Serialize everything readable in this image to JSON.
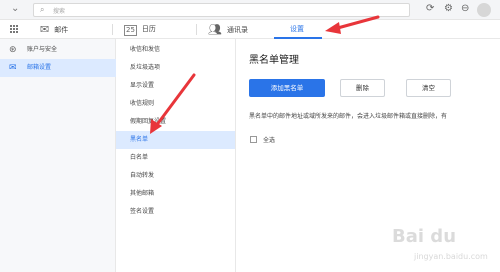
{
  "topbar": {
    "search_placeholder": "搜索",
    "icons": [
      "chevron-down-icon",
      "search-icon",
      "refresh-icon",
      "settings-icon",
      "minimize-icon",
      "avatar"
    ]
  },
  "nav": {
    "items": [
      {
        "label": "邮件",
        "icon": "mail-icon"
      },
      {
        "label": "日历",
        "icon": "calendar-icon",
        "glyph_text": "25"
      },
      {
        "label": "通讯录",
        "icon": "contacts-icon"
      },
      {
        "label": "设置",
        "active": true
      }
    ]
  },
  "sidebar": {
    "items": [
      {
        "label": "账户与安全",
        "icon": "user-icon"
      },
      {
        "label": "邮箱设置",
        "icon": "mailbox-icon",
        "selected": true
      }
    ]
  },
  "subsidebar": {
    "items": [
      {
        "label": "收信和发信"
      },
      {
        "label": "反垃圾选项"
      },
      {
        "label": "显示设置"
      },
      {
        "label": "收信规则"
      },
      {
        "label": "假期回复设置"
      },
      {
        "label": "黑名单",
        "selected": true
      },
      {
        "label": "白名单"
      },
      {
        "label": "自动转发"
      },
      {
        "label": "其他邮箱"
      },
      {
        "label": "签名设置"
      }
    ]
  },
  "main": {
    "title": "黑名单管理",
    "buttons": {
      "add": "添加黑名单",
      "delete": "删除",
      "clear": "清空"
    },
    "description": "黑名单中的邮件地址或域所发来的邮件，会进入垃圾邮件箱或直接删除，有",
    "select_all_label": "全选"
  },
  "watermark": {
    "text": "Bai du",
    "sub": "jingyan.baidu.com"
  },
  "colors": {
    "accent": "#2a74e8",
    "annotation_arrow": "#e8353a",
    "selected_bg": "#dceaff"
  }
}
